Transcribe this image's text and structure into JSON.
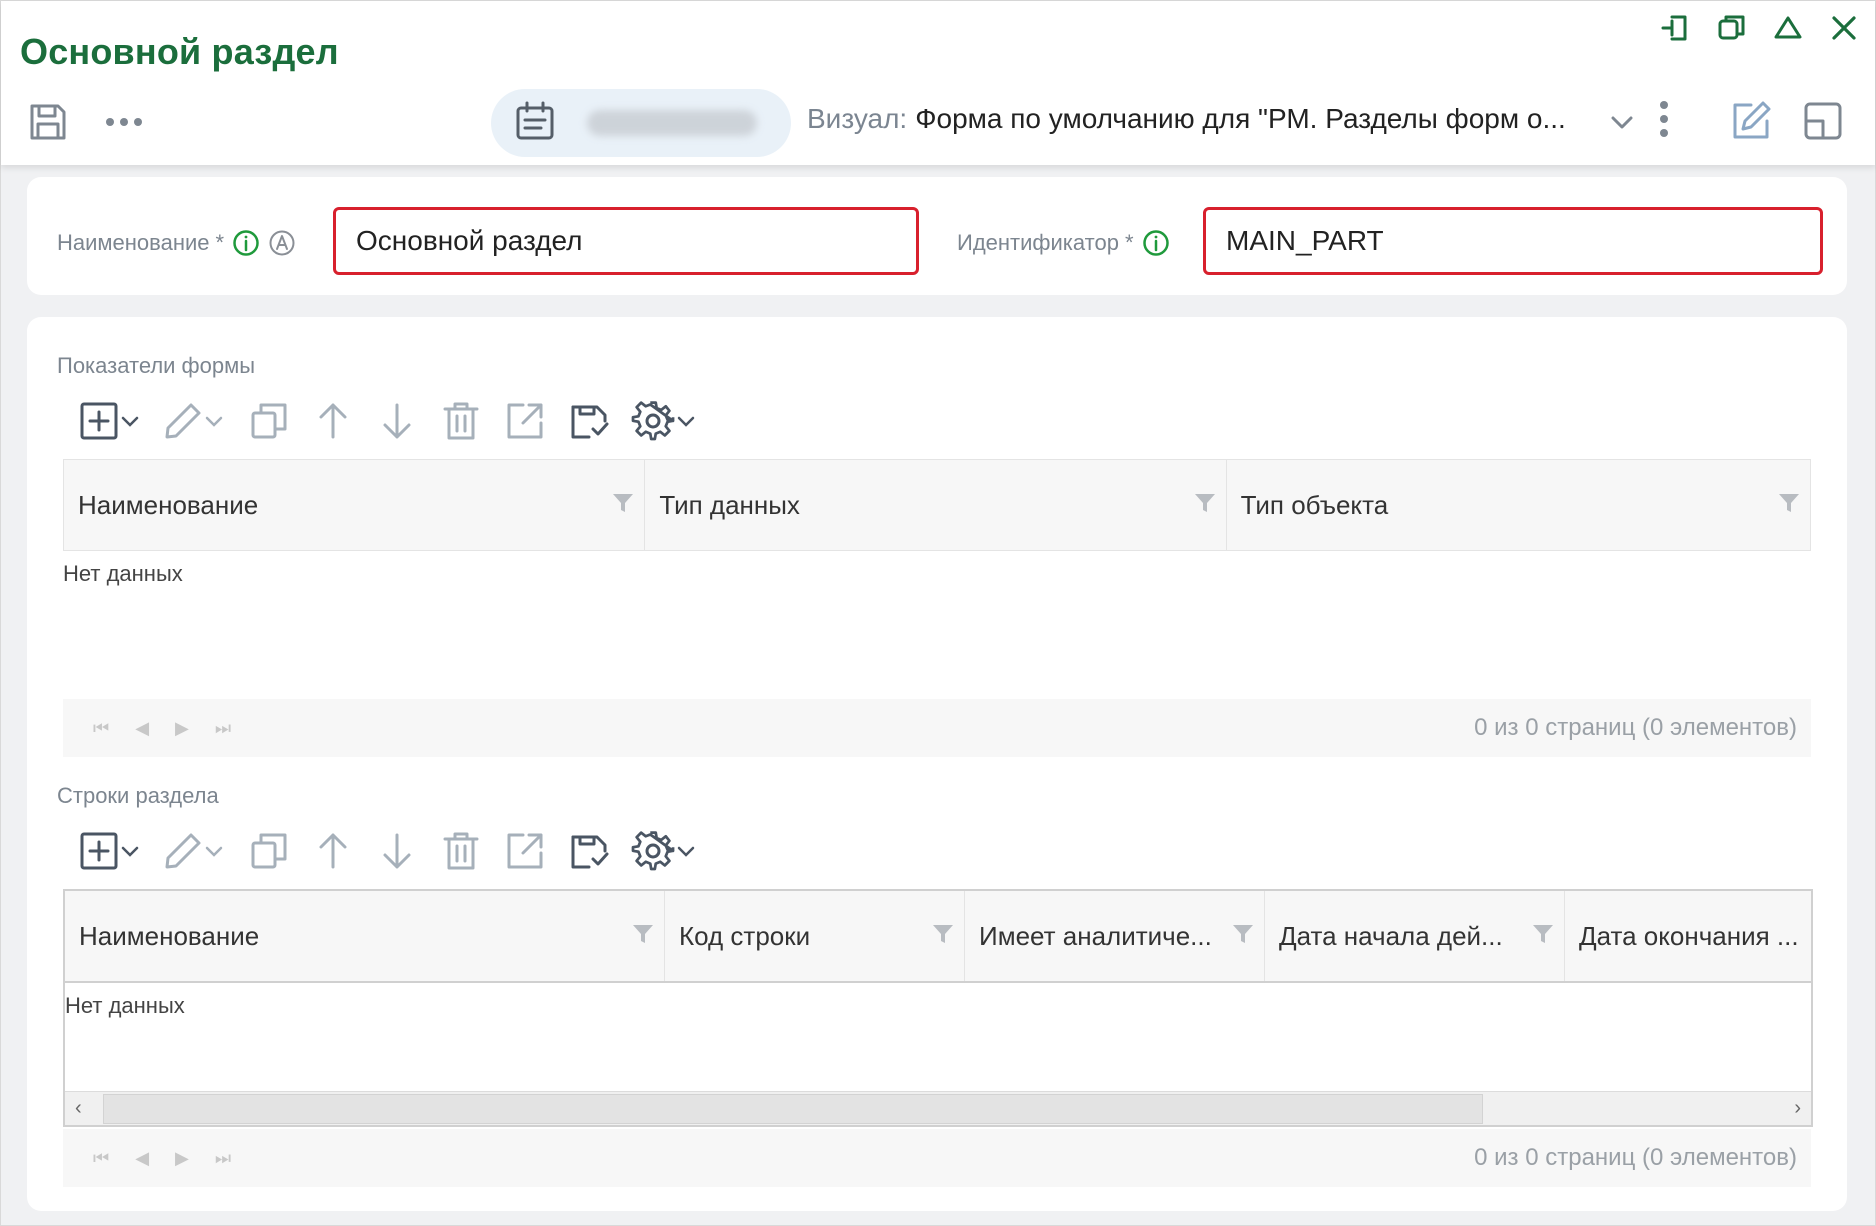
{
  "window": {
    "title": "Основной раздел"
  },
  "toolbar": {
    "visual_label": "Визуал:",
    "visual_value": "Форма по умолчанию для \"РМ. Разделы форм о..."
  },
  "form": {
    "name_label": "Наименование",
    "name_required": "*",
    "name_value": "Основной раздел",
    "id_label": "Идентификатор",
    "id_required": "*",
    "id_value": "MAIN_PART"
  },
  "indicators": {
    "section_title": "Показатели формы",
    "columns": [
      "Наименование",
      "Тип данных",
      "Тип объекта"
    ],
    "no_data": "Нет данных",
    "pager_info": "0 из 0 страниц (0 элементов)"
  },
  "rows": {
    "section_title": "Строки раздела",
    "columns": [
      "Наименование",
      "Код строки",
      "Имеет аналитиче...",
      "Дата начала дей...",
      "Дата окончания ..."
    ],
    "no_data": "Нет данных",
    "pager_info": "0 из 0 страниц (0 элементов)"
  },
  "icons": {
    "window_controls": [
      "pin-icon",
      "restore-icon",
      "collapse-icon",
      "close-icon"
    ],
    "grid_toolbar": [
      "add-icon",
      "edit-icon",
      "copy-icon",
      "move-up-icon",
      "move-down-icon",
      "delete-icon",
      "open-icon",
      "save-view-icon",
      "settings-icon"
    ]
  },
  "colors": {
    "title": "#1b6e3c",
    "required_border": "#d8202d",
    "info_badge": "#1f9a3c",
    "icon_gray": "#7e8791"
  }
}
